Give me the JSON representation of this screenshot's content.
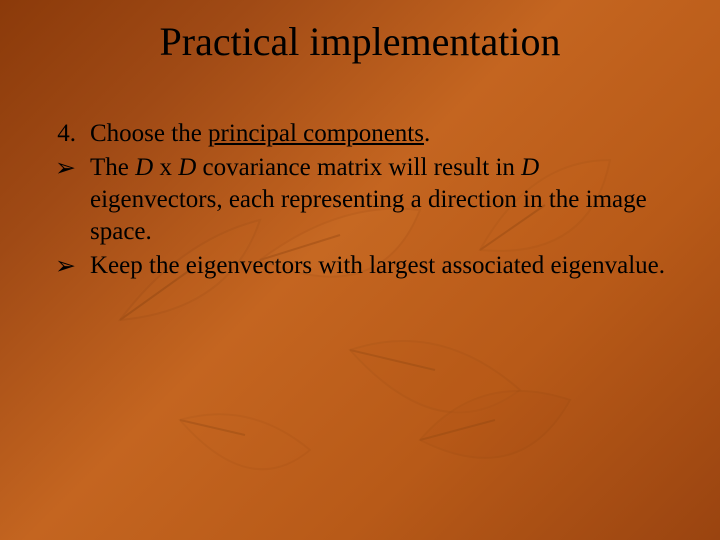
{
  "slide": {
    "title": "Practical implementation",
    "items": [
      {
        "marker": "4.",
        "markerType": "number",
        "runs": [
          {
            "text": "Choose the ",
            "style": ""
          },
          {
            "text": "principal components",
            "style": "underline"
          },
          {
            "text": ".",
            "style": ""
          }
        ]
      },
      {
        "marker": "➢",
        "markerType": "arrow",
        "runs": [
          {
            "text": "The ",
            "style": ""
          },
          {
            "text": "D",
            "style": "italic"
          },
          {
            "text": " x ",
            "style": ""
          },
          {
            "text": "D",
            "style": "italic"
          },
          {
            "text": " covariance matrix will result in ",
            "style": ""
          },
          {
            "text": "D",
            "style": "italic"
          },
          {
            "text": " eigenvectors, each representing a direction in the image space.",
            "style": ""
          }
        ]
      },
      {
        "marker": "➢",
        "markerType": "arrow",
        "runs": [
          {
            "text": "Keep the eigenvectors with largest associated eigenvalue.",
            "style": ""
          }
        ]
      }
    ]
  }
}
